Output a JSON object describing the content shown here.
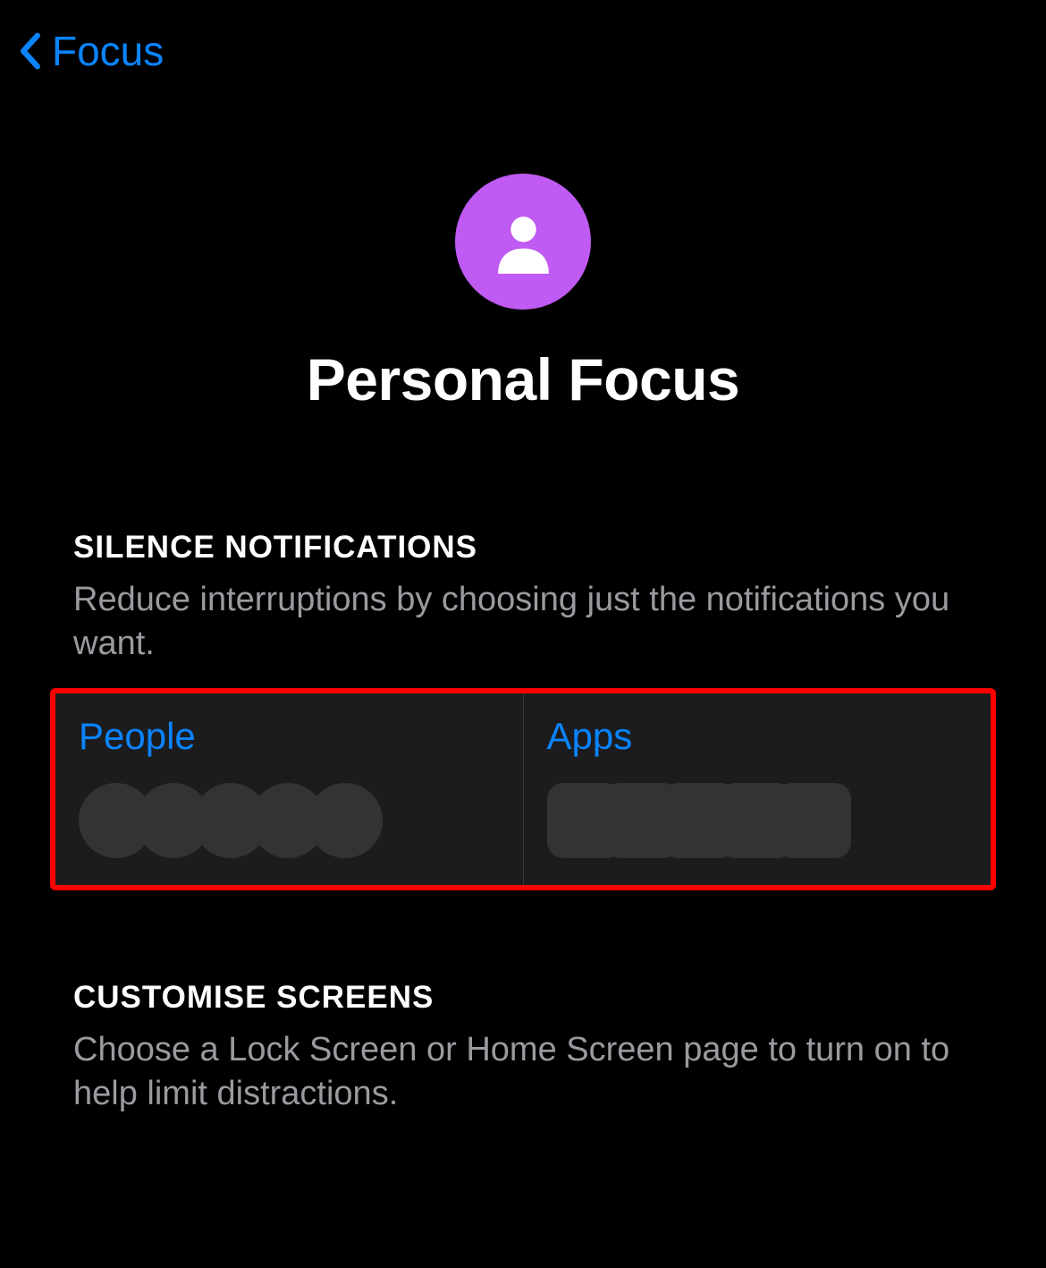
{
  "nav": {
    "back_label": "Focus"
  },
  "header": {
    "icon_color": "#bf5af2",
    "title": "Personal Focus"
  },
  "sections": {
    "silence": {
      "heading": "SILENCE NOTIFICATIONS",
      "description": "Reduce interruptions by choosing just the notifications you want."
    },
    "customise": {
      "heading": "CUSTOMISE SCREENS",
      "description": "Choose a Lock Screen or Home Screen page to turn on to help limit distractions."
    }
  },
  "cards": {
    "people": {
      "label": "People",
      "placeholders": 5
    },
    "apps": {
      "label": "Apps",
      "placeholders": 5
    }
  }
}
